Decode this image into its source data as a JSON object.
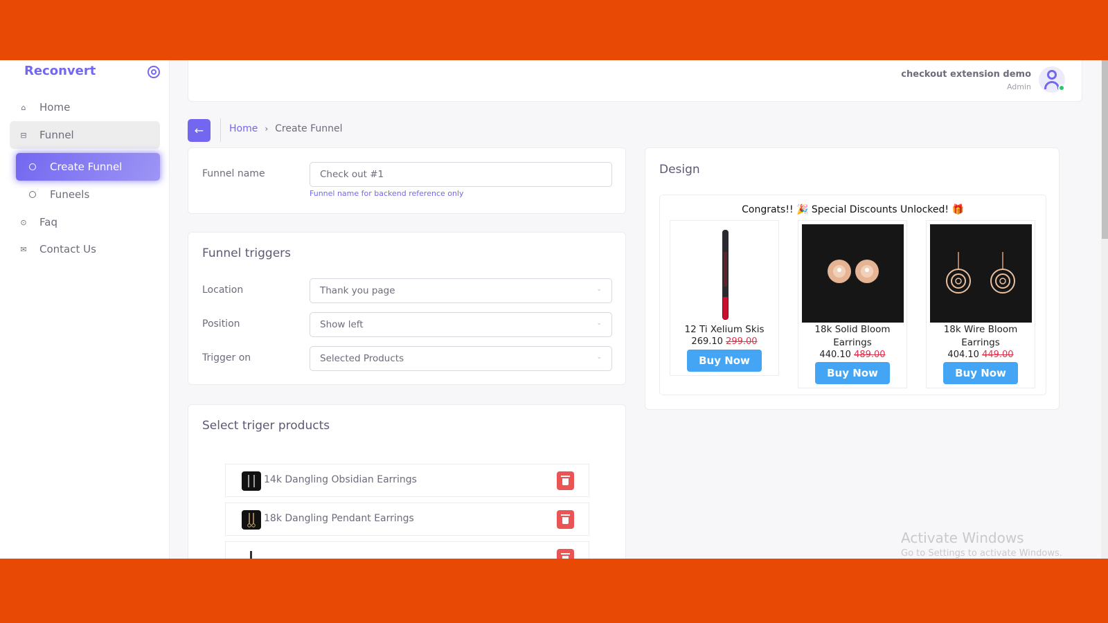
{
  "sidebar": {
    "brand": "Reconvert",
    "items": [
      {
        "label": "Home",
        "icon": "home-icon"
      },
      {
        "label": "Funnel",
        "icon": "layout-icon"
      },
      {
        "label": "Create Funnel",
        "icon": "circle-icon"
      },
      {
        "label": "Funeels",
        "icon": "circle-icon"
      },
      {
        "label": "Faq",
        "icon": "help-circle-icon"
      },
      {
        "label": "Contact Us",
        "icon": "mail-icon"
      }
    ]
  },
  "header": {
    "user_name": "checkout extension demo",
    "user_role": "Admin",
    "status_color": "#28c76f"
  },
  "breadcrumb": {
    "home": "Home",
    "current": "Create Funnel"
  },
  "funnel_name": {
    "label": "Funnel name",
    "value": "Check out #1",
    "hint": "Funnel name for backend reference only"
  },
  "triggers": {
    "title": "Funnel triggers",
    "fields": [
      {
        "label": "Location",
        "value": "Thank you page"
      },
      {
        "label": "Position",
        "value": "Show left"
      },
      {
        "label": "Trigger on",
        "value": "Selected Products"
      }
    ]
  },
  "trigger_products": {
    "title": "Select triger products",
    "items": [
      {
        "name": "14k Dangling Obsidian Earrings"
      },
      {
        "name": "18k Dangling Pendant Earrings"
      },
      {
        "name": ""
      }
    ]
  },
  "design": {
    "title": "Design",
    "banner": "Congrats!! 🎉 Special Discounts Unlocked! 🎁",
    "offers": [
      {
        "title": "12 Ti Xelium Skis",
        "price": "269.10",
        "compare_price": "299.00",
        "button": "Buy Now"
      },
      {
        "title": "18k Solid Bloom Earrings",
        "price": "440.10",
        "compare_price": "489.00",
        "button": "Buy Now"
      },
      {
        "title": "18k Wire Bloom Earrings",
        "price": "404.10",
        "compare_price": "449.00",
        "button": "Buy Now"
      }
    ]
  },
  "watermark": {
    "line1": "Activate Windows",
    "line2": "Go to Settings to activate Windows."
  },
  "colors": {
    "accent": "#7367f0",
    "danger": "#ea5455",
    "buy_button": "#45a5f5",
    "frame": "#e84a06"
  }
}
